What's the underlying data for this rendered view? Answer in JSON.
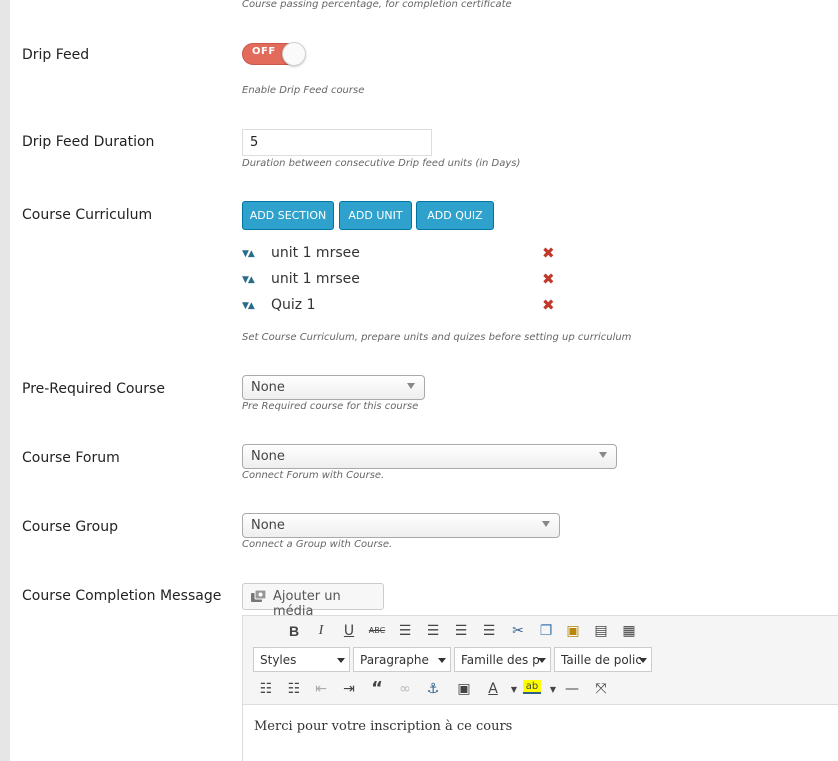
{
  "top_description": "Course passing percentage, for completion certificate",
  "drip_feed": {
    "label": "Drip Feed",
    "toggle_state": "OFF",
    "description": "Enable Drip Feed course"
  },
  "drip_duration": {
    "label": "Drip Feed Duration",
    "value": "5",
    "description": "Duration between consecutive Drip feed units (in Days)"
  },
  "curriculum": {
    "label": "Course Curriculum",
    "buttons": {
      "add_section": "ADD SECTION",
      "add_unit": "ADD UNIT",
      "add_quiz": "ADD QUIZ"
    },
    "items": [
      {
        "name": "unit 1 mrsee"
      },
      {
        "name": "unit 1 mrsee"
      },
      {
        "name": "Quiz 1"
      }
    ],
    "description": "Set Course Curriculum, prepare units and quizes before setting up curriculum",
    "accent_color": "#2ea2cc",
    "delete_color": "#c0392b"
  },
  "pre_required": {
    "label": "Pre-Required Course",
    "selected": "None",
    "description": "Pre Required course for this course"
  },
  "forum": {
    "label": "Course Forum",
    "selected": "None",
    "description": "Connect Forum with Course."
  },
  "group": {
    "label": "Course Group",
    "selected": "None",
    "description": "Connect a Group with Course."
  },
  "completion_message": {
    "label": "Course Completion Message",
    "media_button": "Ajouter un média",
    "toolbar": {
      "styles": "Styles",
      "paragraph": "Paragraphe",
      "font_family": "Famille des p",
      "font_size": "Taille de polic"
    },
    "content": "Merci pour votre inscription à ce cours"
  }
}
